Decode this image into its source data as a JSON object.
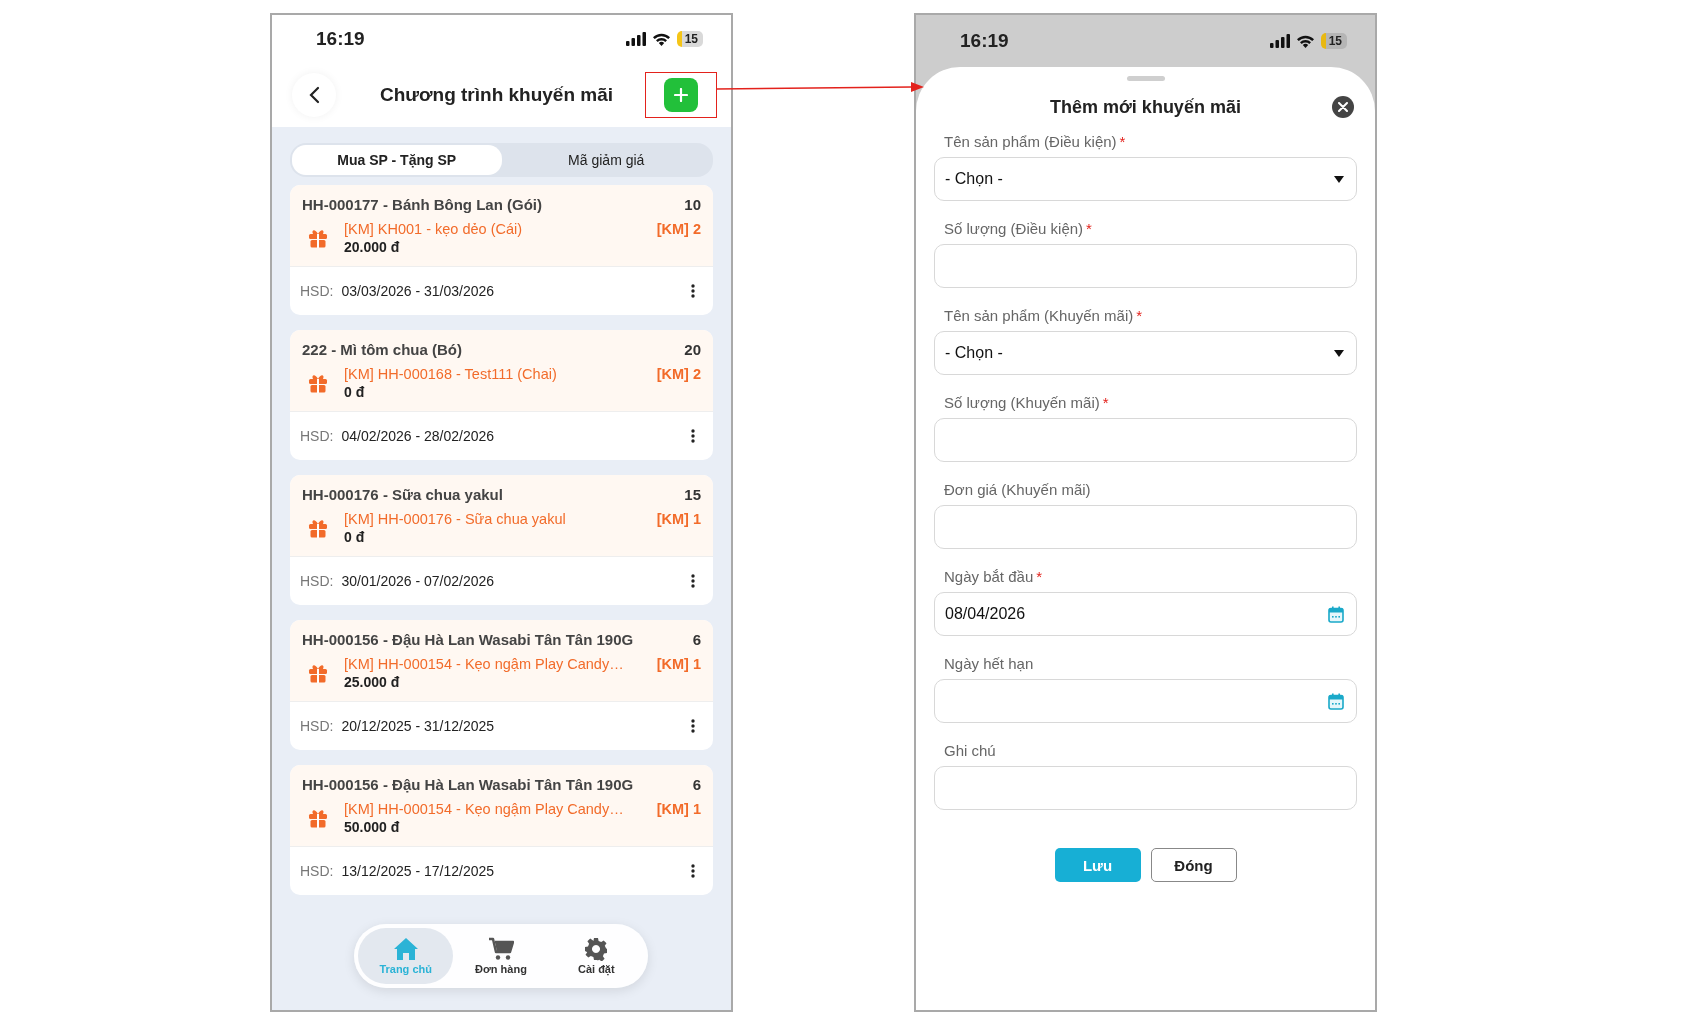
{
  "left_screen": {
    "status_bar": {
      "time": "16:19",
      "battery": "15"
    },
    "header": {
      "title": "Chương trình khuyến mãi"
    },
    "tabs": [
      {
        "label": "Mua SP - Tặng SP",
        "selected": true
      },
      {
        "label": "Mã giảm giá",
        "selected": false
      }
    ],
    "promotions": [
      {
        "product": "HH-000177 - Bánh Bông Lan (Gói)",
        "quantity": "10",
        "gift": "[KM] KH001 - kẹo dẻo (Cái)",
        "gift_quantity": "[KM] 2",
        "price": "20.000 đ",
        "validity_label": "HSD:",
        "validity": "03/03/2026 - 31/03/2026"
      },
      {
        "product": "222 - Mì tôm chua (Bó)",
        "quantity": "20",
        "gift": "[KM] HH-000168 - Test111 (Chai)",
        "gift_quantity": "[KM] 2",
        "price": "0 đ",
        "validity_label": "HSD:",
        "validity": "04/02/2026 - 28/02/2026"
      },
      {
        "product": "HH-000176 - Sữa chua yakul",
        "quantity": "15",
        "gift": "[KM] HH-000176 - Sữa chua yakul",
        "gift_quantity": "[KM] 1",
        "price": "0 đ",
        "validity_label": "HSD:",
        "validity": "30/01/2026 - 07/02/2026"
      },
      {
        "product": "HH-000156 - Đậu Hà Lan Wasabi Tân Tân 190G",
        "quantity": "6",
        "gift": "[KM] HH-000154 - Kẹo ngậm Play Candy…",
        "gift_quantity": "[KM] 1",
        "price": "25.000 đ",
        "validity_label": "HSD:",
        "validity": "20/12/2025 - 31/12/2025"
      },
      {
        "product": "HH-000156 - Đậu Hà Lan Wasabi Tân Tân 190G",
        "quantity": "6",
        "gift": "[KM] HH-000154 - Kẹo ngậm Play Candy…",
        "gift_quantity": "[KM] 1",
        "price": "50.000 đ",
        "validity_label": "HSD:",
        "validity": "13/12/2025 - 17/12/2025"
      }
    ],
    "bottom_nav": [
      {
        "label": "Trang chủ",
        "selected": true
      },
      {
        "label": "Đơn hàng",
        "selected": false
      },
      {
        "label": "Cài đặt",
        "selected": false
      }
    ]
  },
  "right_screen": {
    "status_bar": {
      "time": "16:19",
      "battery": "15"
    },
    "sheet": {
      "title": "Thêm mới khuyến mãi",
      "fields": [
        {
          "label": "Tên sản phẩm (Điều kiện)",
          "required_mark": "*",
          "kind": "select",
          "value": "- Chọn -"
        },
        {
          "label": "Số lượng (Điều kiện)",
          "required_mark": "*",
          "kind": "text"
        },
        {
          "label": "Tên sản phẩm (Khuyến mãi)",
          "required_mark": "*",
          "kind": "select",
          "value": "- Chọn -"
        },
        {
          "label": "Số lượng (Khuyến mãi)",
          "required_mark": "*",
          "kind": "text"
        },
        {
          "label": "Đơn giá (Khuyến mãi)",
          "kind": "text"
        },
        {
          "label": "Ngày bắt đầu",
          "required_mark": "*",
          "kind": "date",
          "value": "08/04/2026"
        },
        {
          "label": "Ngày hết hạn",
          "kind": "date"
        },
        {
          "label": "Ghi chú",
          "kind": "text"
        }
      ],
      "buttons": [
        {
          "label": "Lưu",
          "kind": "primary"
        },
        {
          "label": "Đóng",
          "kind": "secondary"
        }
      ]
    }
  }
}
